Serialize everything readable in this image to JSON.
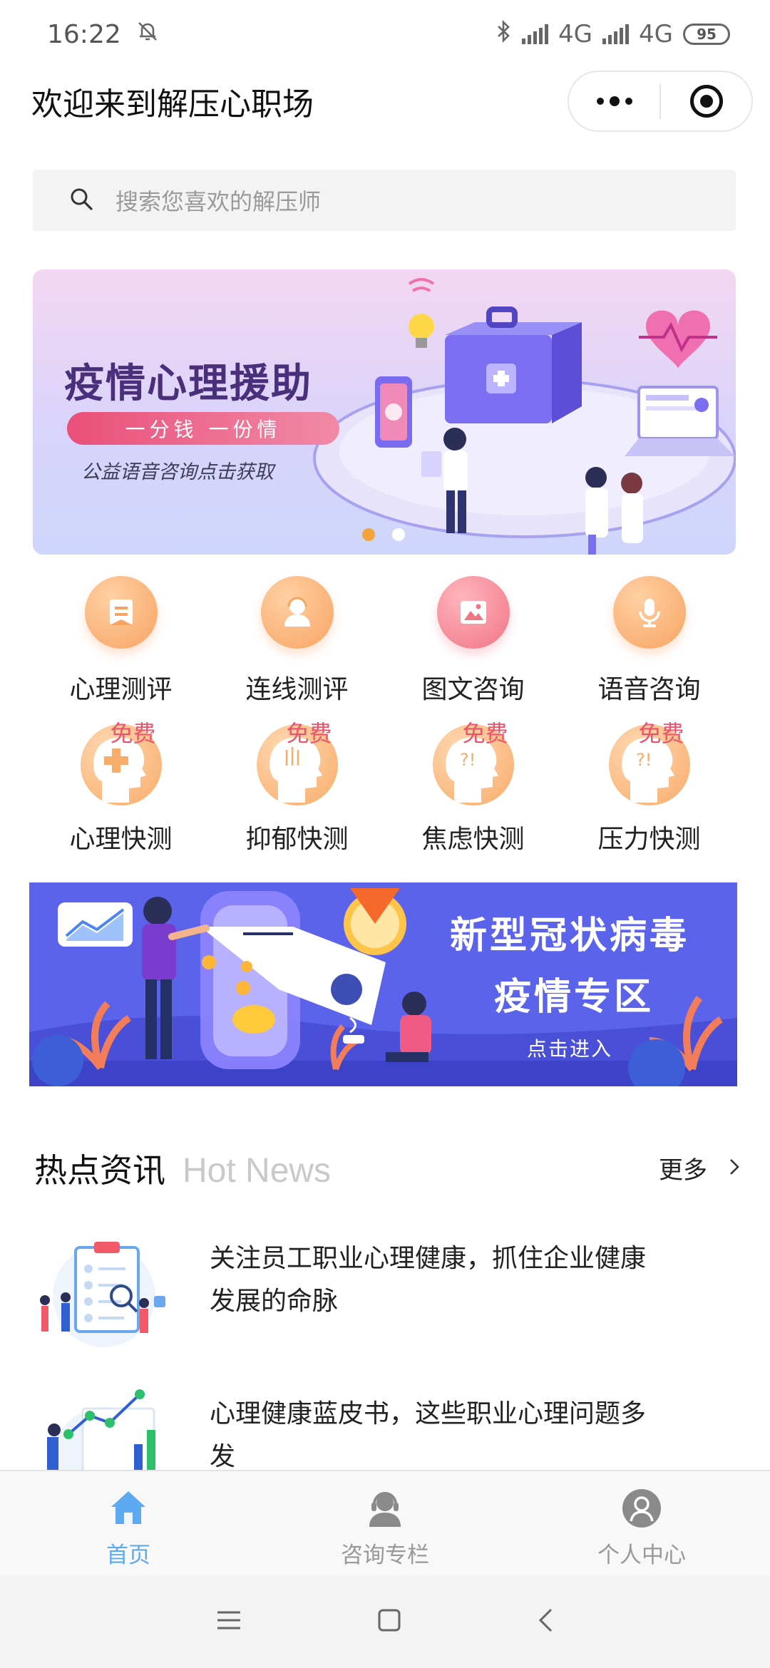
{
  "status_bar": {
    "time": "16:22",
    "network_1": "4G",
    "network_2": "4G",
    "battery": "95"
  },
  "title_bar": {
    "title": "欢迎来到解压心职场"
  },
  "search": {
    "placeholder": "搜索您喜欢的解压师"
  },
  "banner_main": {
    "headline": "疫情心理援助",
    "pill": "一分钱 一份情",
    "subline": "公益语音咨询点击获取",
    "slide_count": 2,
    "active_slide": 1
  },
  "services": [
    {
      "label": "心理测评",
      "icon": "document-icon"
    },
    {
      "label": "连线测评",
      "icon": "counselor-icon"
    },
    {
      "label": "图文咨询",
      "icon": "image-icon"
    },
    {
      "label": "语音咨询",
      "icon": "microphone-icon"
    }
  ],
  "quick_tests": [
    {
      "label": "心理快测",
      "tag": "免费",
      "icon": "head-plus-icon"
    },
    {
      "label": "抑郁快测",
      "tag": "免费",
      "icon": "head-lines-icon"
    },
    {
      "label": "焦虑快测",
      "tag": "免费",
      "icon": "head-question-icon"
    },
    {
      "label": "压力快测",
      "tag": "免费",
      "icon": "head-question-icon"
    }
  ],
  "banner_covid": {
    "title_line1": "新型冠状病毒",
    "title_line2": "疫情专区",
    "cta": "点击进入"
  },
  "hot_news": {
    "title": "热点资讯",
    "subtitle": "Hot News",
    "more": "更多",
    "items": [
      {
        "line1": "关注员工职业心理健康，抓住企业健康",
        "line2": "发展的命脉"
      },
      {
        "line1": "心理健康蓝皮书，这些职业心理问题多",
        "line2": "发"
      }
    ]
  },
  "tabbar": {
    "tabs": [
      {
        "label": "首页",
        "active": true
      },
      {
        "label": "咨询专栏",
        "active": false
      },
      {
        "label": "个人中心",
        "active": false
      }
    ]
  },
  "colors": {
    "accent_blue": "#5eaaf0",
    "icon_orange": "#f7a462",
    "icon_pink": "#f07585",
    "free_tag": "#e9546b",
    "covid_banner": "#5b63eb"
  }
}
